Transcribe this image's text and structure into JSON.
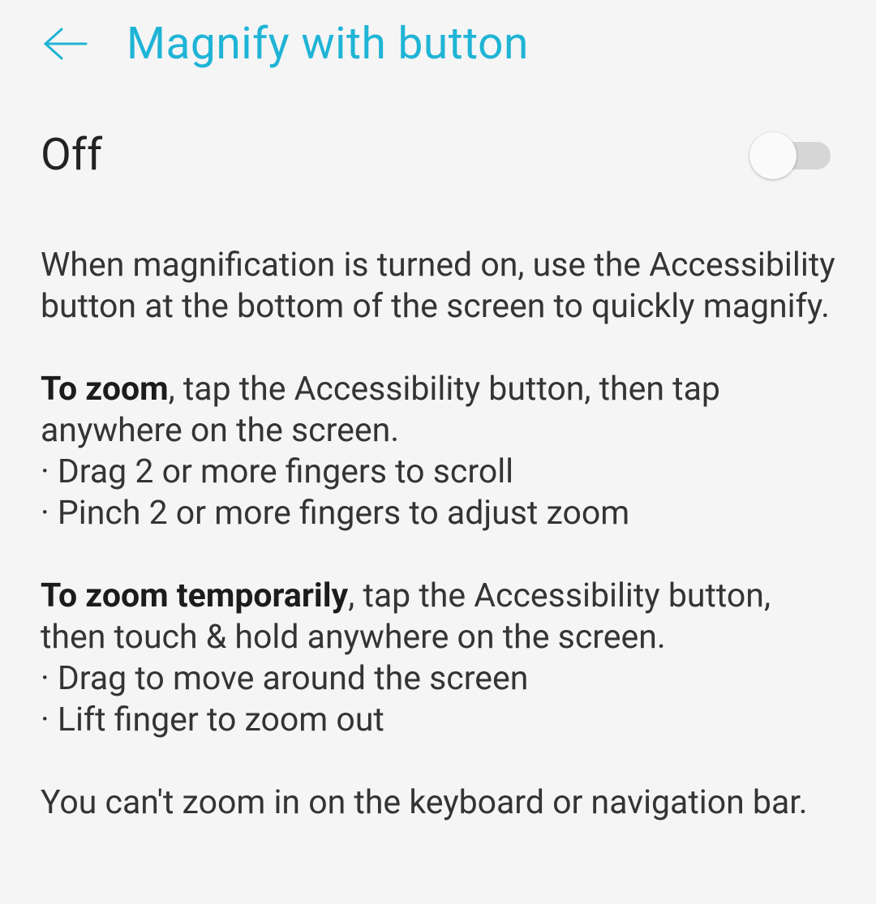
{
  "header": {
    "title": "Magnify with button"
  },
  "toggle": {
    "state_label": "Off",
    "enabled": false
  },
  "description": {
    "intro": "When magnification is turned on, use the Accessibility button at the bottom of the screen to quickly magnify.",
    "zoom_bold": "To zoom",
    "zoom_rest": ", tap the Accessibility button, then tap anywhere on the screen.",
    "zoom_bullet1": "· Drag 2 or more fingers to scroll",
    "zoom_bullet2": "· Pinch 2 or more fingers to adjust zoom",
    "temp_bold": "To zoom temporarily",
    "temp_rest": ", tap the Accessibility button, then touch & hold anywhere on the screen.",
    "temp_bullet1": "· Drag to move around the screen",
    "temp_bullet2": "· Lift finger to zoom out",
    "footer": "You can't zoom in on the keyboard or navigation bar."
  }
}
